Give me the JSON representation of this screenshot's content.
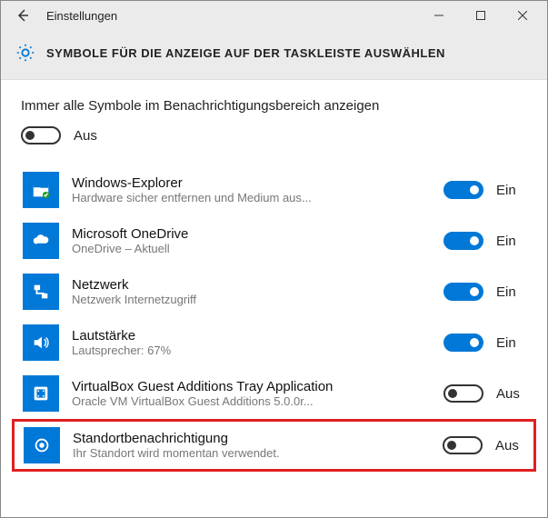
{
  "window": {
    "title": "Einstellungen"
  },
  "page": {
    "heading": "SYMBOLE FÜR DIE ANZEIGE AUF DER TASKLEISTE AUSWÄHLEN"
  },
  "master": {
    "label": "Immer alle Symbole im Benachrichtigungsbereich anzeigen",
    "state": "Aus",
    "on": false
  },
  "state_labels": {
    "on": "Ein",
    "off": "Aus"
  },
  "items": [
    {
      "title": "Windows-Explorer",
      "sub": "Hardware sicher entfernen und Medium aus...",
      "on": true,
      "state": "Ein",
      "icon": "explorer"
    },
    {
      "title": "Microsoft OneDrive",
      "sub": "OneDrive – Aktuell",
      "on": true,
      "state": "Ein",
      "icon": "onedrive"
    },
    {
      "title": "Netzwerk",
      "sub": "Netzwerk Internetzugriff",
      "on": true,
      "state": "Ein",
      "icon": "network"
    },
    {
      "title": "Lautstärke",
      "sub": "Lautsprecher: 67%",
      "on": true,
      "state": "Ein",
      "icon": "volume"
    },
    {
      "title": "VirtualBox Guest Additions Tray Application",
      "sub": "Oracle VM VirtualBox Guest Additions 5.0.0r...",
      "on": false,
      "state": "Aus",
      "icon": "vbox"
    },
    {
      "title": "Standortbenachrichtigung",
      "sub": "Ihr Standort wird momentan verwendet.",
      "on": false,
      "state": "Aus",
      "icon": "location",
      "highlighted": true
    }
  ]
}
